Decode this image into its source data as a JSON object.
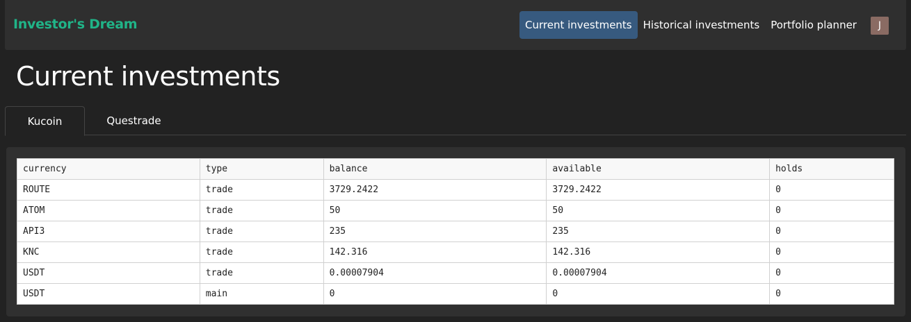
{
  "navbar": {
    "brand": "Investor's Dream",
    "links": [
      {
        "label": "Current investments",
        "active": true
      },
      {
        "label": "Historical investments",
        "active": false
      },
      {
        "label": "Portfolio planner",
        "active": false
      }
    ],
    "avatar_initial": "J"
  },
  "page": {
    "title": "Current investments"
  },
  "tabs": [
    {
      "label": "Kucoin",
      "active": true
    },
    {
      "label": "Questrade",
      "active": false
    }
  ],
  "table": {
    "columns": [
      "currency",
      "type",
      "balance",
      "available",
      "holds"
    ],
    "rows": [
      [
        "ROUTE",
        "trade",
        "3729.2422",
        "3729.2422",
        "0"
      ],
      [
        "ATOM",
        "trade",
        "50",
        "50",
        "0"
      ],
      [
        "API3",
        "trade",
        "235",
        "235",
        "0"
      ],
      [
        "KNC",
        "trade",
        "142.316",
        "142.316",
        "0"
      ],
      [
        "USDT",
        "trade",
        "0.00007904",
        "0.00007904",
        "0"
      ],
      [
        "USDT",
        "main",
        "0",
        "0",
        "0"
      ]
    ]
  },
  "colors": {
    "brand": "#20b488",
    "nav_active": "#375a7f",
    "navbar_bg": "#2f2f2f",
    "page_bg": "#222222",
    "avatar_bg": "#8a6b63"
  }
}
